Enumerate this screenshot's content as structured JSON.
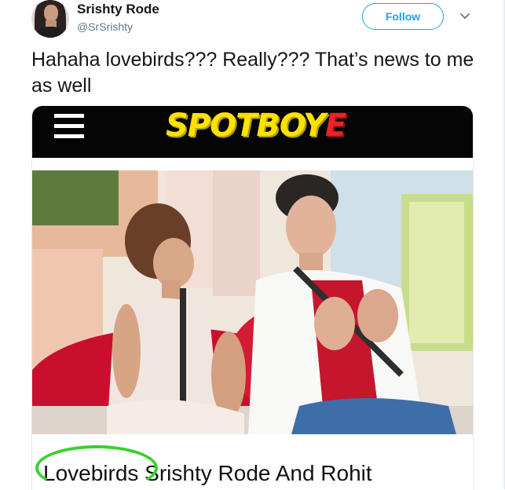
{
  "tweet": {
    "display_name": "Srishty Rode",
    "handle": "@SrSrishty",
    "follow_label": "Follow",
    "text": "Hahaha lovebirds??? Really??? That’s news to me as well"
  },
  "card": {
    "site_logo": "SPOTBOY",
    "site_logo_accent": "E",
    "headline": "Lovebirds Srishty Rode And Rohit"
  },
  "colors": {
    "accent": "#1da1f2",
    "logo_yellow": "#ffe100",
    "logo_red": "#e8232a",
    "highlight_circle": "#39d12c"
  },
  "icons": [
    "avatar",
    "chevron-down-icon",
    "hamburger-menu-icon"
  ]
}
